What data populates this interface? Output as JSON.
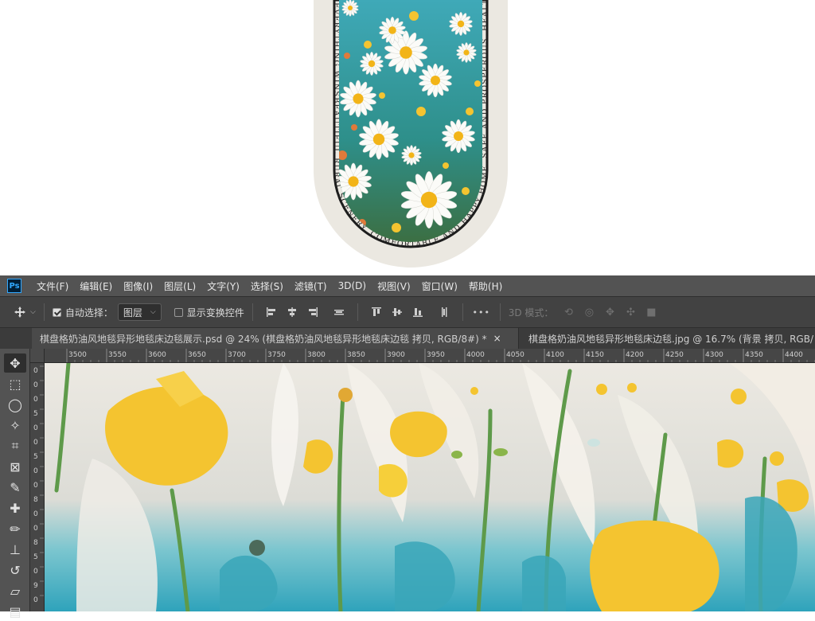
{
  "preview": {
    "rug_text": "EVERYTHING WINSBEAUTIFUL RURAL SCENERY, COMFORTABLE AND HAPPY HOME, SAFE AND PROSPEROUS, HEALTHY BODY, AND"
  },
  "app": {
    "logo": "Ps"
  },
  "menu": [
    {
      "label": "文件(F)"
    },
    {
      "label": "编辑(E)"
    },
    {
      "label": "图像(I)"
    },
    {
      "label": "图层(L)"
    },
    {
      "label": "文字(Y)"
    },
    {
      "label": "选择(S)"
    },
    {
      "label": "滤镜(T)"
    },
    {
      "label": "3D(D)"
    },
    {
      "label": "视图(V)"
    },
    {
      "label": "窗口(W)"
    },
    {
      "label": "帮助(H)"
    }
  ],
  "options": {
    "auto_select_label": "自动选择：",
    "auto_select_checked": true,
    "layer_dropdown_value": "图层",
    "show_transform_label": "显示变换控件",
    "show_transform_checked": false,
    "mode_3d_label": "3D 模式：",
    "more_label": "•••"
  },
  "tabs": [
    {
      "label": "棋盘格奶油风地毯异形地毯床边毯展示.psd @ 24% (棋盘格奶油风地毯异形地毯床边毯 拷贝, RGB/8#) *",
      "close": "×",
      "active": true
    },
    {
      "label": "棋盘格奶油风地毯异形地毯床边毯.jpg @ 16.7% (背景 拷贝, RGB/",
      "active": false
    }
  ],
  "ruler": {
    "h_ticks": [
      "3500",
      "3550",
      "3600",
      "3650",
      "3700",
      "3750",
      "3800",
      "3850",
      "3900",
      "3950",
      "4000",
      "4050",
      "4100",
      "4150",
      "4200",
      "4250",
      "4300",
      "4350",
      "4400"
    ],
    "v_ticks": [
      "0",
      "0",
      "0",
      "5",
      "0",
      "0",
      "5",
      "0",
      "0",
      "8",
      "0",
      "0",
      "8",
      "5",
      "0",
      "9",
      "0"
    ]
  },
  "tools": [
    {
      "icon": "move-icon"
    },
    {
      "icon": "marquee-icon"
    },
    {
      "icon": "lasso-icon"
    },
    {
      "icon": "magic-wand-icon"
    },
    {
      "icon": "crop-icon"
    },
    {
      "icon": "frame-icon"
    },
    {
      "icon": "eyedropper-icon"
    },
    {
      "icon": "healing-brush-icon"
    },
    {
      "icon": "brush-icon"
    },
    {
      "icon": "clone-stamp-icon"
    },
    {
      "icon": "history-brush-icon"
    },
    {
      "icon": "eraser-icon"
    },
    {
      "icon": "gradient-icon"
    }
  ],
  "colors": {
    "menubar_bg": "#535353",
    "options_bg": "#424242",
    "tabs_bg": "#3b3b3b",
    "ruler_bg": "#464646",
    "canvas_teal": "#4aaec0",
    "canvas_yellow": "#f4c430",
    "canvas_cream": "#e9e6df",
    "ps_blue": "#31a8ff"
  }
}
